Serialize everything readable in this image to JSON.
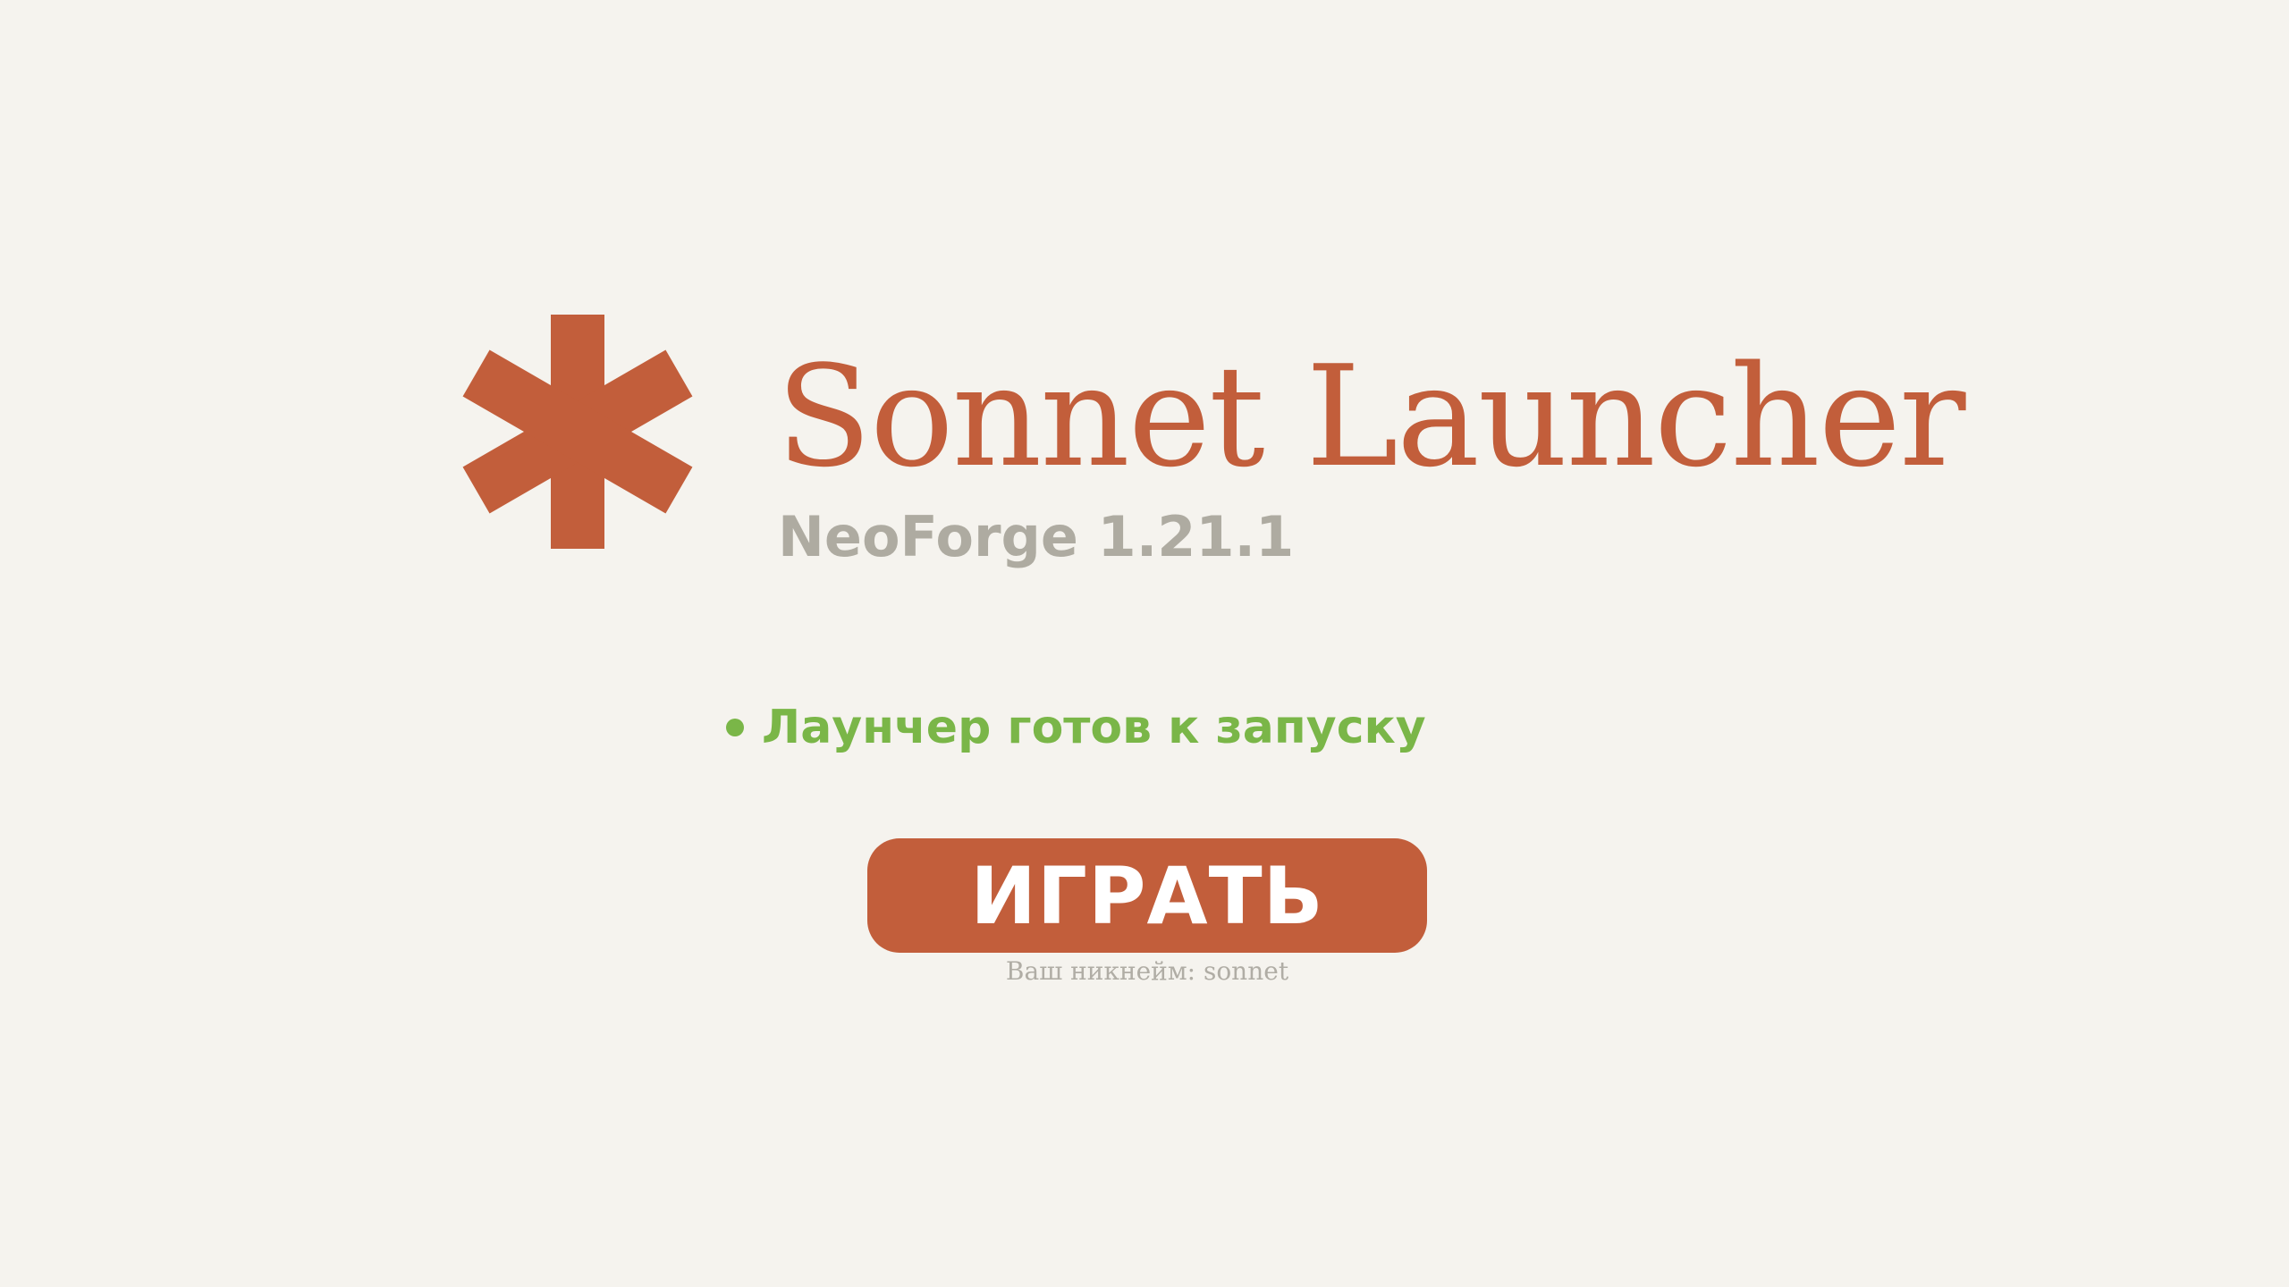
{
  "app": {
    "title": "Sonnet Launcher",
    "version": "NeoForge 1.21.1",
    "logo_icon": "asterisk-logo-icon"
  },
  "status": {
    "text": "Лаунчер готов к запуску",
    "indicator_icon": "status-dot-icon",
    "color": "#7ab648"
  },
  "play": {
    "label": "ИГРАТЬ"
  },
  "user": {
    "nickname_text": "Ваш никнейм: sonnet"
  },
  "colors": {
    "accent": "#c25e3b",
    "background": "#f5f3ee",
    "muted": "#aeaba1",
    "success": "#7ab648"
  }
}
